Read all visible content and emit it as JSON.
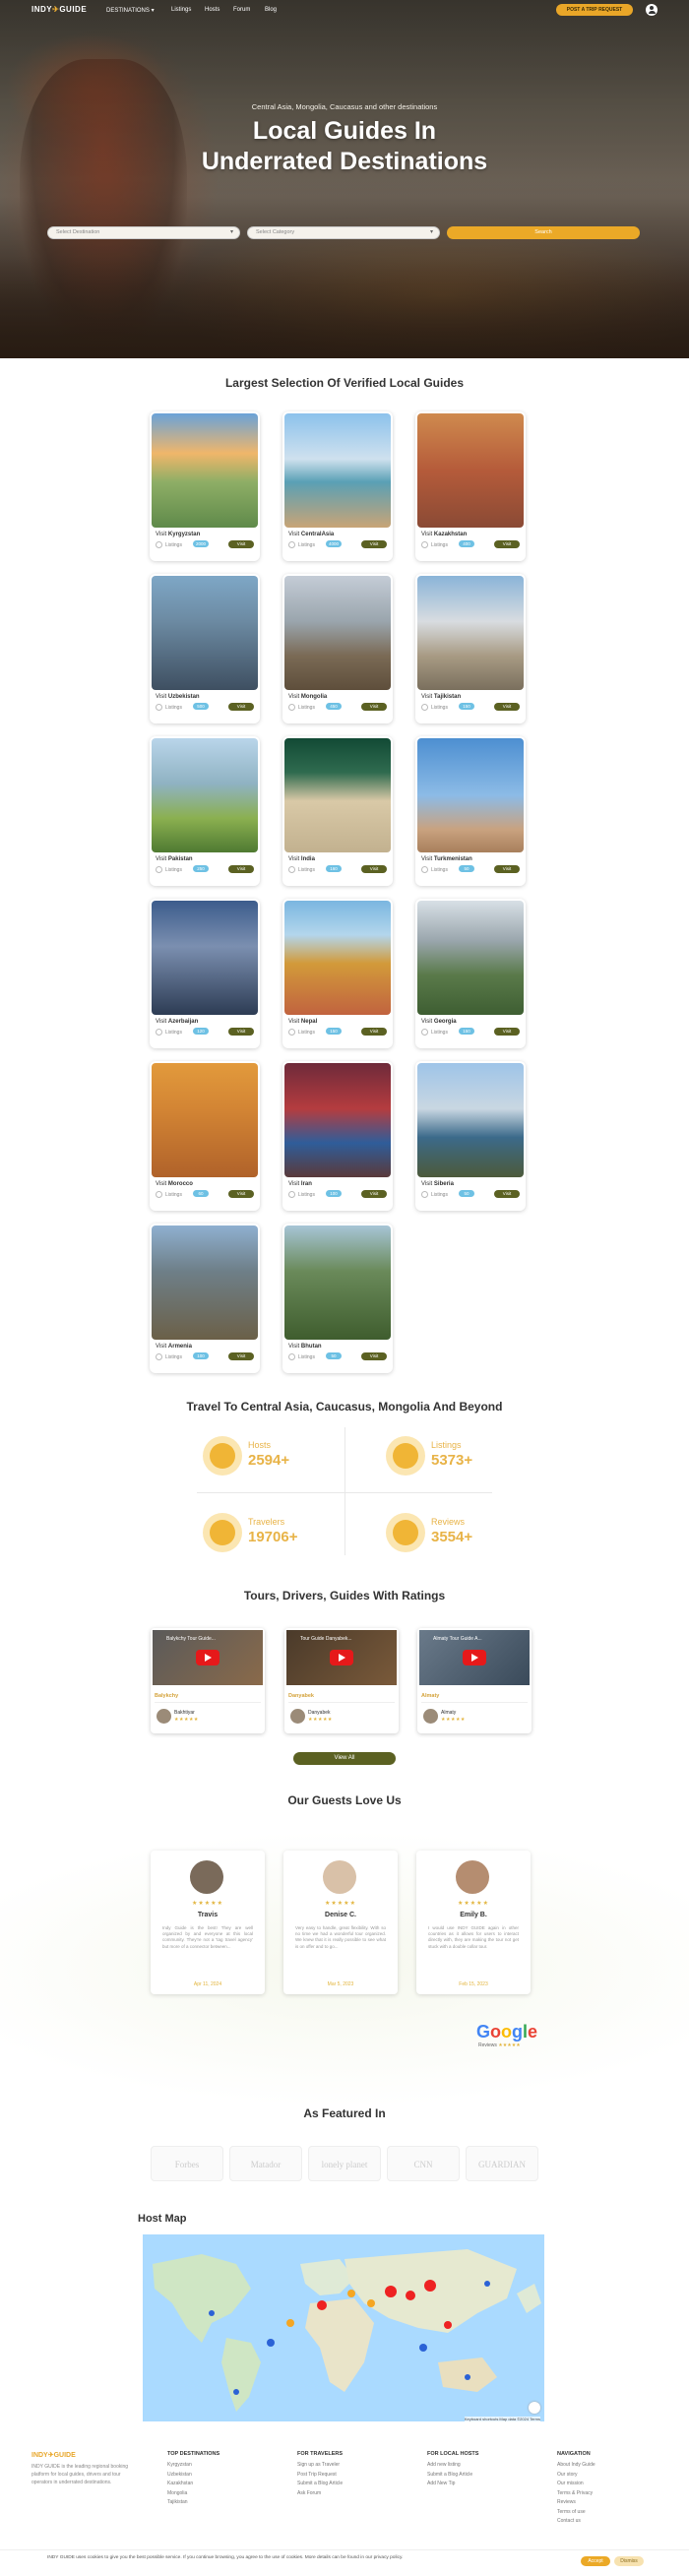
{
  "nav": {
    "logo_a": "INDY",
    "logo_b": "GUIDE",
    "links": [
      "DESTINATIONS",
      "Listings",
      "Hosts",
      "Forum",
      "Blog"
    ],
    "cta": "POST A TRIP REQUEST"
  },
  "hero": {
    "subtitle": "Central Asia, Mongolia, Caucasus and other destinations",
    "title_line1": "Local Guides In",
    "title_line2": "Underrated Destinations",
    "dest_placeholder": "Select Destination",
    "cat_placeholder": "Select Category",
    "search_label": "Search"
  },
  "selection": {
    "title": "Largest Selection Of Verified Local Guides",
    "visit": "Visit",
    "listings": "Listings",
    "button": "Visit",
    "cards": [
      {
        "name": "Kyrgyzstan",
        "count": "2000"
      },
      {
        "name": "CentralAsia",
        "count": "4000"
      },
      {
        "name": "Kazakhstan",
        "count": "400"
      },
      {
        "name": "Uzbekistan",
        "count": "500"
      },
      {
        "name": "Mongolia",
        "count": "450"
      },
      {
        "name": "Tajikistan",
        "count": "150"
      },
      {
        "name": "Pakistan",
        "count": "250"
      },
      {
        "name": "India",
        "count": "160"
      },
      {
        "name": "Turkmenistan",
        "count": "50"
      },
      {
        "name": "Azerbaijan",
        "count": "120"
      },
      {
        "name": "Nepal",
        "count": "150"
      },
      {
        "name": "Georgia",
        "count": "150"
      },
      {
        "name": "Morocco",
        "count": "60"
      },
      {
        "name": "Iran",
        "count": "100"
      },
      {
        "name": "Siberia",
        "count": "50"
      },
      {
        "name": "Armenia",
        "count": "100"
      },
      {
        "name": "Bhutan",
        "count": "50"
      }
    ]
  },
  "stats": {
    "title": "Travel To Central Asia, Caucasus, Mongolia And Beyond",
    "items": [
      {
        "label": "Hosts",
        "value": "2594+"
      },
      {
        "label": "Listings",
        "value": "5373+"
      },
      {
        "label": "Travelers",
        "value": "19706+"
      },
      {
        "label": "Reviews",
        "value": "3554+"
      }
    ]
  },
  "tours": {
    "title": "Tours, Drivers, Guides With Ratings",
    "items": [
      {
        "video": "Balykchy Tour Guide...",
        "location": "Balykchy",
        "name": "Bakhtiyar",
        "stars": "★★★★★"
      },
      {
        "video": "Tour Guide Danyabek...",
        "location": "Danyabek",
        "name": "Danyabek",
        "stars": "★★★★★"
      },
      {
        "video": "Almaty Tour Guide A...",
        "location": "Almaty",
        "name": "Almaty",
        "stars": "★★★★★"
      }
    ],
    "view_all": "View All"
  },
  "reviews": {
    "title": "Our Guests Love Us",
    "stars": "★★★★★",
    "items": [
      {
        "name": "Travis",
        "text": "Indy Guide is the best! They are well organized by and everyone at this local community. They're not a 'tag travel agency' but more of a connector between...",
        "date": "Apr 11, 2024"
      },
      {
        "name": "Denise C.",
        "text": "Very easy to handle, great flexibility. With so no time we had a wonderful tour organized. We knew that it is really possible to see what is on offer and to go...",
        "date": "Mar 5, 2023"
      },
      {
        "name": "Emily B.",
        "text": "I would use INDY GUIDE again in other countries as it allows for users to interact directly with, they are making the tour not get stuck with a double collar tour.",
        "date": "Feb 15, 2023"
      }
    ],
    "google": "Google",
    "google_sub": "Reviews"
  },
  "featured": {
    "title": "As Featured In",
    "logos": [
      "Forbes",
      "Matador",
      "lonely planet",
      "CNN",
      "GUARDIAN"
    ]
  },
  "map": {
    "title": "Host Map",
    "attribution": "Keyboard shortcuts  Map data ©2024  Terms"
  },
  "footer": {
    "brand_a": "INDY",
    "brand_b": "GUIDE",
    "about": "INDY GUIDE is the leading regional booking platform for local guides, drivers and tour operators in underrated destinations.",
    "cols": [
      {
        "title": "TOP DESTINATIONS",
        "links": [
          "Kyrgyzstan",
          "Uzbekistan",
          "Kazakhstan",
          "Mongolia",
          "Tajikistan"
        ]
      },
      {
        "title": "FOR TRAVELERS",
        "links": [
          "Sign up as Traveler",
          "Post Trip Request",
          "Submit a Blog Article",
          "Ask Forum"
        ]
      },
      {
        "title": "FOR LOCAL HOSTS",
        "links": [
          "Add new listing",
          "Submit a Blog Article",
          "Add New Tip"
        ]
      },
      {
        "title": "NAVIGATION",
        "links": [
          "About Indy Guide",
          "Our story",
          "Our mission",
          "Terms & Privacy",
          "Reviews",
          "Terms of use",
          "Contact us"
        ]
      }
    ]
  },
  "cookie": {
    "text": "INDY GUIDE uses cookies to give you the best possible service. If you continue browsing, you agree to the use of cookies. More details can be found in our privacy policy.",
    "accept": "Accept",
    "dismiss": "Dismiss"
  },
  "colors": {
    "accent": "#eba927",
    "olive": "#5b6122",
    "badge": "#6ec1e4"
  }
}
